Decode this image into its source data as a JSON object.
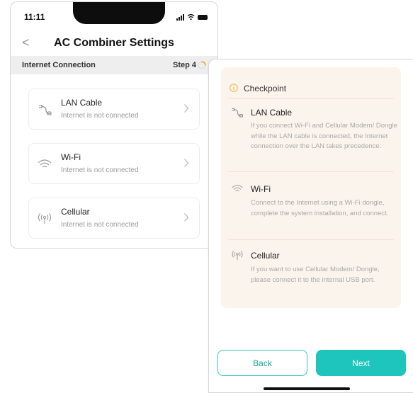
{
  "status_bar": {
    "time": "11:11",
    "icons": [
      "signal-icon",
      "wifi-icon",
      "battery-icon"
    ]
  },
  "nav": {
    "back_glyph": "<",
    "title": "AC Combiner Settings"
  },
  "step_bar": {
    "label": "Internet Connection",
    "step": "Step 4",
    "progress_fraction": 0.25
  },
  "connections": [
    {
      "icon": "lan-cable-icon",
      "title": "LAN Cable",
      "status": "Internet is not connected"
    },
    {
      "icon": "wifi-icon",
      "title": "Wi-Fi",
      "status": "Internet is not connected"
    },
    {
      "icon": "cellular-icon",
      "title": "Cellular",
      "status": "Internet is not connected"
    }
  ],
  "checkpoint": {
    "header": "Checkpoint",
    "items": [
      {
        "icon": "lan-cable-icon",
        "title": "LAN Cable",
        "description": "If you connect Wi-Fi and Cellular Modem/ Dongle while the LAN cable is connected, the Internet connection over the LAN takes precedence."
      },
      {
        "icon": "wifi-icon",
        "title": "Wi-Fi",
        "description": "Connect to the Internet using a Wi-Fi dongle, complete the system installation, and connect."
      },
      {
        "icon": "cellular-icon",
        "title": "Cellular",
        "description": "If you want to use Cellular Modem/ Dongle, please connect it to the internal USB port."
      }
    ]
  },
  "buttons": {
    "back": "Back",
    "next": "Next"
  },
  "colors": {
    "accent": "#1ec5bc",
    "progress": "#f5a623",
    "checkpoint_bg": "#fbf4ec",
    "info_icon": "#f0b24a"
  }
}
